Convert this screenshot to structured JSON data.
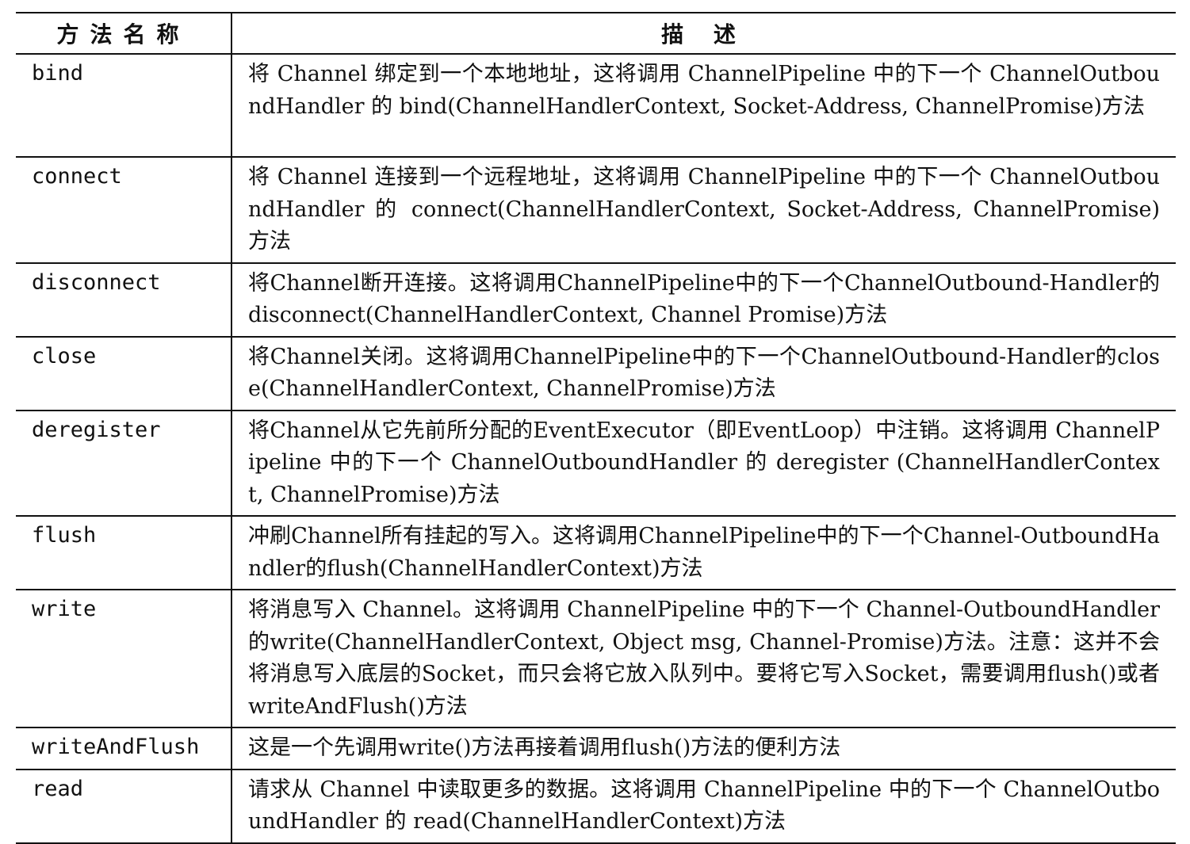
{
  "table": {
    "header": {
      "name": "方法名称",
      "description": "描 述"
    },
    "rows": [
      {
        "name": "bind",
        "description": "将 Channel 绑定到一个本地地址，这将调用 ChannelPipeline 中的下一个 ChannelOutboundHandler 的 bind(ChannelHandlerContext, Socket-Address, ChannelPromise)方法"
      },
      {
        "name": "connect",
        "description": "将 Channel 连接到一个远程地址，这将调用 ChannelPipeline 中的下一个 ChannelOutboundHandler 的 connect(ChannelHandlerContext, Socket-Address, ChannelPromise)方法"
      },
      {
        "name": "disconnect",
        "description": "将Channel断开连接。这将调用ChannelPipeline中的下一个ChannelOutbound-Handler的disconnect(ChannelHandlerContext, Channel Promise)方法"
      },
      {
        "name": "close",
        "description": "将Channel关闭。这将调用ChannelPipeline中的下一个ChannelOutbound-Handler的close(ChannelHandlerContext, ChannelPromise)方法"
      },
      {
        "name": "deregister",
        "description": "将Channel从它先前所分配的EventExecutor（即EventLoop）中注销。这将调用 ChannelPipeline 中的下一个 ChannelOutboundHandler 的 deregister (ChannelHandlerContext, ChannelPromise)方法"
      },
      {
        "name": "flush",
        "description": "冲刷Channel所有挂起的写入。这将调用ChannelPipeline中的下一个Channel-OutboundHandler的flush(ChannelHandlerContext)方法"
      },
      {
        "name": "write",
        "description": "将消息写入 Channel。这将调用 ChannelPipeline 中的下一个 Channel-OutboundHandler的write(ChannelHandlerContext, Object msg, Channel-Promise)方法。注意：这并不会将消息写入底层的Socket，而只会将它放入队列中。要将它写入Socket，需要调用flush()或者writeAndFlush()方法"
      },
      {
        "name": "writeAndFlush",
        "description": "这是一个先调用write()方法再接着调用flush()方法的便利方法"
      },
      {
        "name": "read",
        "description": "请求从 Channel 中读取更多的数据。这将调用 ChannelPipeline 中的下一个 ChannelOutboundHandler 的 read(ChannelHandlerContext)方法"
      }
    ]
  }
}
